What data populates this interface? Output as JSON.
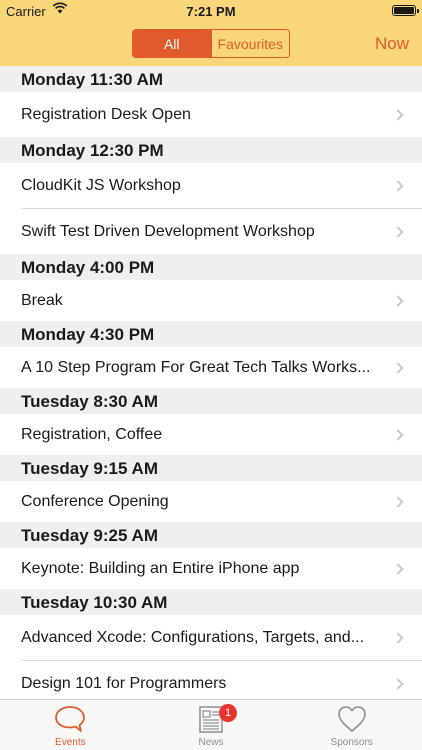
{
  "status_bar": {
    "carrier": "Carrier",
    "time": "7:21 PM"
  },
  "nav": {
    "segments": [
      "All",
      "Favourites"
    ],
    "selected_segment": "All",
    "now_label": "Now",
    "accent_color": "#e05a2b",
    "bar_color": "#f9d67a"
  },
  "schedule": [
    {
      "time": "Monday 11:30 AM",
      "events": [
        "Registration Desk Open"
      ]
    },
    {
      "time": "Monday 12:30 PM",
      "events": [
        "CloudKit JS Workshop",
        "Swift Test Driven Development Workshop"
      ]
    },
    {
      "time": "Monday 4:00 PM",
      "events": [
        "Break"
      ]
    },
    {
      "time": "Monday 4:30 PM",
      "events": [
        "A 10 Step Program For Great Tech Talks Works..."
      ]
    },
    {
      "time": "Tuesday 8:30 AM",
      "events": [
        "Registration, Coffee"
      ]
    },
    {
      "time": "Tuesday 9:15 AM",
      "events": [
        "Conference Opening"
      ]
    },
    {
      "time": "Tuesday 9:25 AM",
      "events": [
        "Keynote: Building an Entire iPhone app"
      ]
    },
    {
      "time": "Tuesday 10:30 AM",
      "events": [
        "Advanced Xcode: Configurations,  Targets, and...",
        "Design 101 for Programmers"
      ]
    }
  ],
  "tabbar": {
    "tabs": [
      {
        "label": "Events",
        "icon": "speech-bubble-icon",
        "active": true
      },
      {
        "label": "News",
        "icon": "newspaper-icon",
        "badge": "1"
      },
      {
        "label": "Sponsors",
        "icon": "heart-icon"
      }
    ]
  }
}
